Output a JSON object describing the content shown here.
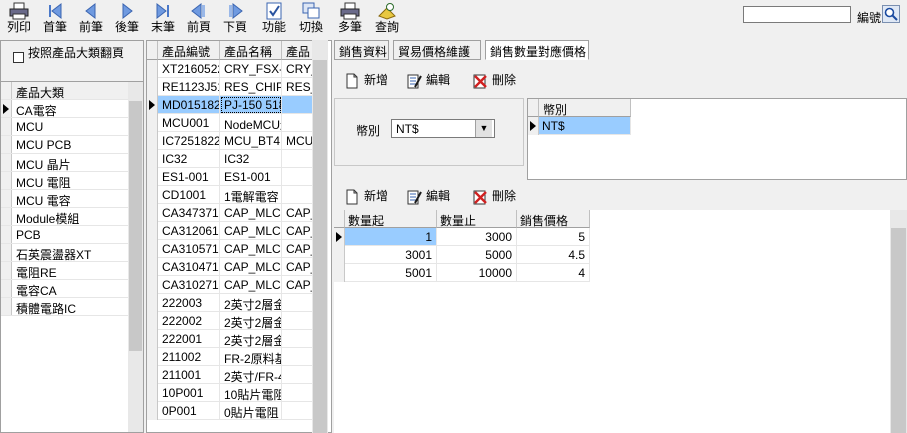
{
  "toolbar": {
    "buttons": [
      "列印",
      "首筆",
      "前筆",
      "後筆",
      "末筆",
      "前頁",
      "下頁",
      "功能",
      "切換",
      "多筆",
      "查詢"
    ],
    "search_value": "",
    "search_label": "編號"
  },
  "category_panel": {
    "checkbox_label": "按照產品大類翻頁",
    "header": "產品大類",
    "items": [
      "CA電容",
      "MCU",
      "MCU PCB",
      "MCU 晶片",
      "MCU 電阻",
      "MCU 電容",
      "Module模組",
      "PCB",
      "石英震盪器XT",
      "電阻RE",
      "電容CA",
      "積體電路IC"
    ]
  },
  "product_panel": {
    "headers": [
      "產品編號",
      "產品名稱",
      "產品"
    ],
    "rows": [
      [
        "XT2160522",
        "CRY_FSX-2",
        "CRY_"
      ],
      [
        "RE1123J51",
        "RES_CHIP",
        "RES_"
      ],
      [
        "MD0151822",
        "PJ-150 518",
        ""
      ],
      [
        "MCU001",
        "NodeMCU連",
        ""
      ],
      [
        "IC7251822€",
        "MCU_BT4.0",
        "MCU_"
      ],
      [
        "IC32",
        "IC32",
        ""
      ],
      [
        "ES1-001",
        "ES1-001",
        ""
      ],
      [
        "CD1001",
        "1電解電容",
        ""
      ],
      [
        "CA3473712",
        "CAP_MLCC",
        "CAP_"
      ],
      [
        "CA3120612",
        "CAP_MLCC",
        "CAP_"
      ],
      [
        "CA3105712",
        "CAP_MLCC",
        "CAP_"
      ],
      [
        "CA3104712",
        "CAP_MLCC",
        "CAP_"
      ],
      [
        "CA3102712",
        "CAP_MLCC",
        "CAP_"
      ],
      [
        "222003",
        "2英寸2層金",
        ""
      ],
      [
        "222002",
        "2英寸2層金",
        ""
      ],
      [
        "222001",
        "2英寸2層金",
        ""
      ],
      [
        "211002",
        "FR-2原料基",
        ""
      ],
      [
        "211001",
        "2英寸/FR-4",
        ""
      ],
      [
        "10P001",
        "10貼片電阻",
        ""
      ],
      [
        "0P001",
        "0貼片電阻",
        ""
      ]
    ],
    "selected_index": 2
  },
  "tabs": [
    "銷售資料",
    "貿易價格維護",
    "銷售數量對應價格"
  ],
  "active_tab": 2,
  "upper_toolbar": {
    "add": "新增",
    "edit": "編輯",
    "delete": "刪除"
  },
  "currency": {
    "label": "幣別",
    "value": "NT$"
  },
  "currency_grid": {
    "header": "幣別",
    "rows": [
      "NT$"
    ]
  },
  "lower_toolbar": {
    "add": "新增",
    "edit": "編輯",
    "delete": "刪除"
  },
  "qty_grid": {
    "headers": [
      "數量起",
      "數量止",
      "銷售價格"
    ],
    "rows": [
      [
        "1",
        "3000",
        "5"
      ],
      [
        "3001",
        "5000",
        "4.5"
      ],
      [
        "5001",
        "10000",
        "4"
      ]
    ]
  },
  "colors": {
    "selection": "#99ccff",
    "selection_text": "#000000"
  }
}
